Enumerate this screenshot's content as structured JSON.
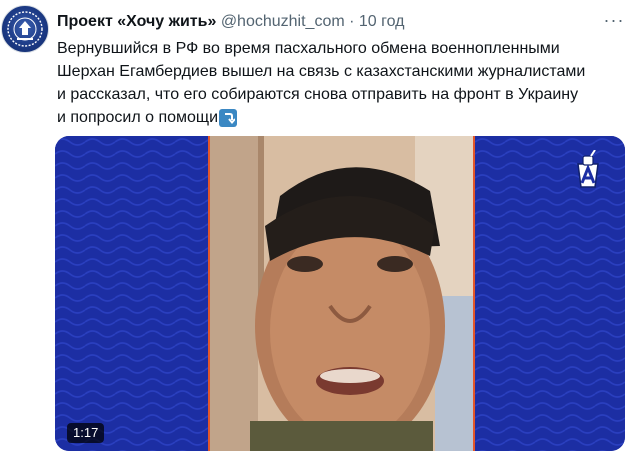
{
  "tweet": {
    "author": {
      "display_name": "Проект «Хочу жить»",
      "handle": "@hochuzhit_com",
      "separator": "·",
      "time": "10 год",
      "avatar_icon": "organization-emblem-icon"
    },
    "more_icon": "more-options-icon",
    "more_glyph": "···",
    "text_lines": [
      "Вернувшийся в РФ во время пасхального обмена военнопленными",
      "Шерхан Егамбердиев вышел на связь с казахстанскими журналистами",
      "и рассказал, что его собираются снова отправить на фронт в Украину",
      "и попросил о помощи"
    ],
    "emoji_icon": "arrow-return-down-icon",
    "media": {
      "type": "video",
      "duration": "1:17",
      "channel_logo_icon": "letter-a-cup-logo-icon",
      "accent_color": "#1c2ea3",
      "frame_color": "#e2572a"
    }
  }
}
